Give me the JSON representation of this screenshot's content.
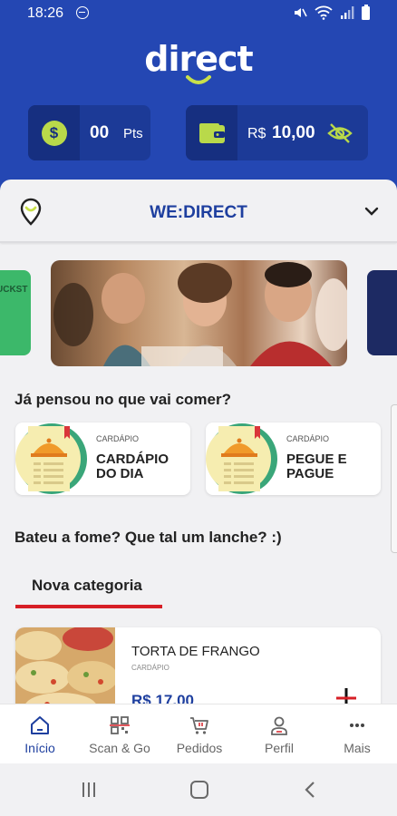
{
  "status": {
    "time": "18:26"
  },
  "brand": {
    "logo_text": "direct"
  },
  "wallet": {
    "points_value": "00",
    "points_unit": "Pts",
    "currency_symbol": "R$",
    "balance": "10,00"
  },
  "location": {
    "name": "WE:DIRECT"
  },
  "carousel": {
    "left_card_text": "UCKST"
  },
  "menu_section": {
    "title": "Já pensou no que vai comer?",
    "cards": [
      {
        "kicker": "CARDÁPIO",
        "name": "CARDÁPIO DO DIA"
      },
      {
        "kicker": "CARDÁPIO",
        "name": "PEGUE E PAGUE"
      }
    ]
  },
  "snack_section": {
    "title": "Bateu a fome? Que tal um lanche? :)"
  },
  "category_tab": {
    "label": "Nova categoria"
  },
  "product": {
    "name": "TORTA DE FRANGO",
    "kicker": "CARDÁPIO",
    "price": "R$ 17,00"
  },
  "bottom_nav": {
    "items": [
      {
        "label": "Início",
        "icon": "home-icon"
      },
      {
        "label": "Scan & Go",
        "icon": "qr-code-icon"
      },
      {
        "label": "Pedidos",
        "icon": "cart-icon"
      },
      {
        "label": "Perfil",
        "icon": "person-icon"
      },
      {
        "label": "Mais",
        "icon": "more-icon"
      }
    ]
  },
  "colors": {
    "header": "#2447b3",
    "accent_green": "#b9d94a",
    "brand_blue": "#1e3f9f",
    "tab_red": "#d71f26"
  }
}
